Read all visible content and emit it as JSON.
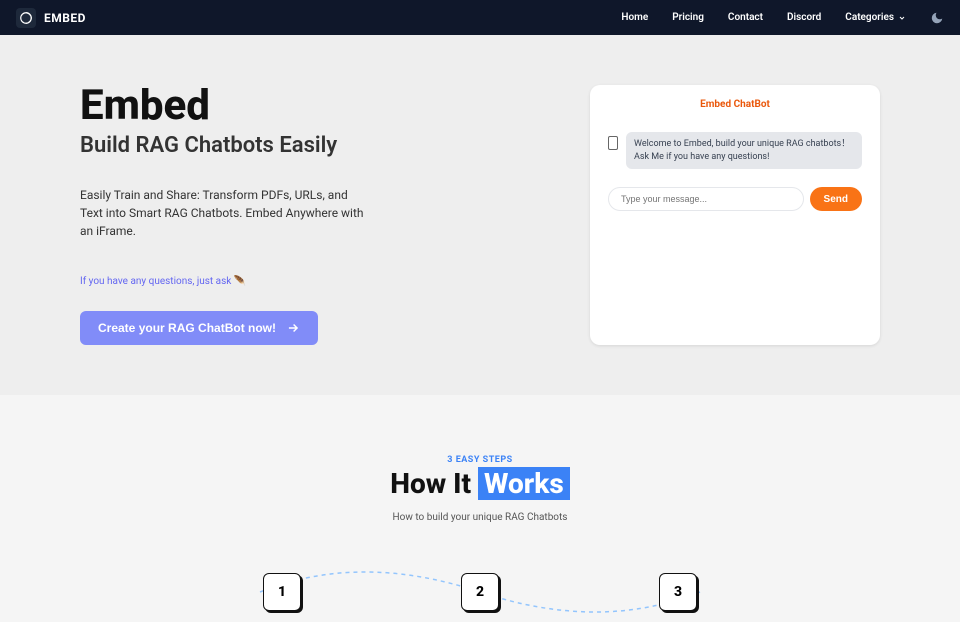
{
  "nav": {
    "brand": "EMBED",
    "links": [
      "Home",
      "Pricing",
      "Contact",
      "Discord",
      "Categories"
    ]
  },
  "hero": {
    "title": "Embed",
    "subtitle": "Build RAG Chatbots Easily",
    "description": "Easily Train and Share: Transform PDFs, URLs, and Text into Smart RAG Chatbots. Embed Anywhere with an iFrame.",
    "note": "If you have any questions, just ask 🪶",
    "cta": "Create your RAG ChatBot now!"
  },
  "chatbot": {
    "title": "Embed ChatBot",
    "welcome": "Welcome to Embed, build your unique RAG chatbots！ Ask Me if you have any questions!",
    "placeholder": "Type your message...",
    "send": "Send"
  },
  "how": {
    "label": "3 EASY STEPS",
    "title_prefix": "How It ",
    "title_highlight": "Works",
    "description": "How to build your unique RAG Chatbots",
    "steps": [
      "1",
      "2",
      "3"
    ]
  }
}
